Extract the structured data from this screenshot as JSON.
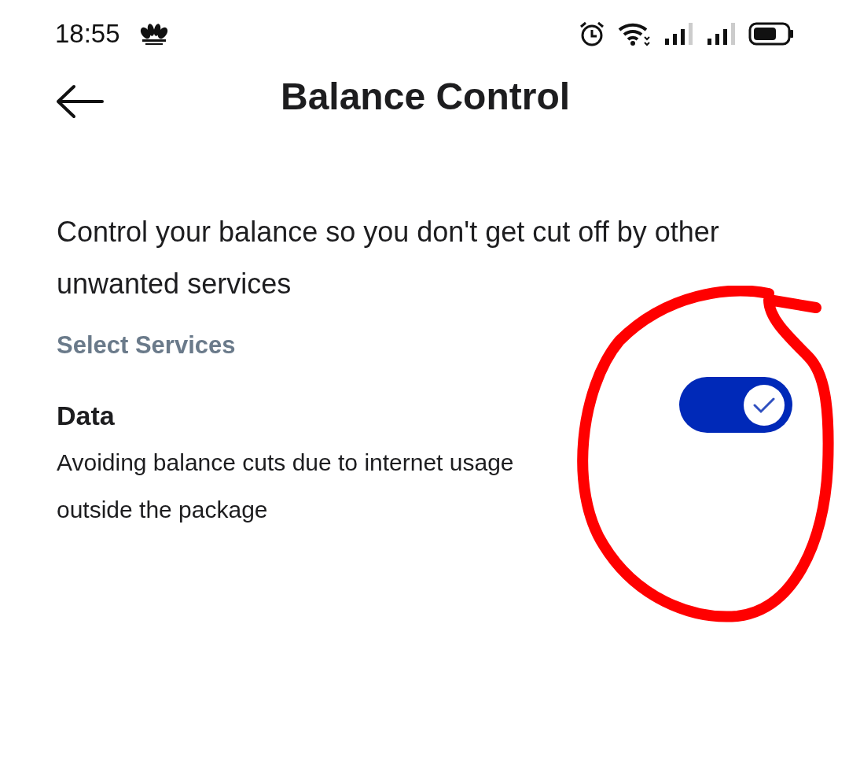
{
  "status_bar": {
    "time": "18:55"
  },
  "header": {
    "title": "Balance Control"
  },
  "intro": "Control your balance so you don't get cut off by other unwanted services",
  "section_label": "Select Services",
  "services": [
    {
      "title": "Data",
      "description": "Avoiding balance cuts due to internet usage outside the package",
      "on": true,
      "annotation": {
        "kind": "circle"
      }
    }
  ]
}
